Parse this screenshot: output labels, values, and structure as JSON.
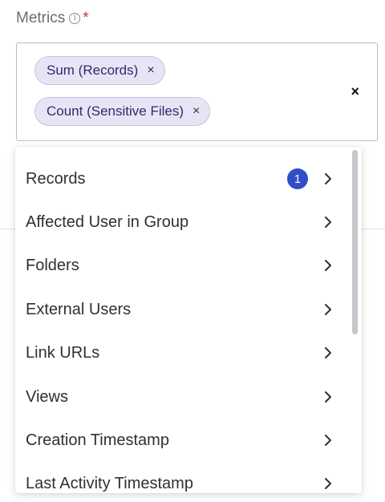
{
  "field": {
    "label": "Metrics",
    "info_glyph": "i",
    "required_mark": "*"
  },
  "selected_chips": [
    {
      "label": "Sum (Records)",
      "remove_glyph": "×"
    },
    {
      "label": "Count (Sensitive Files)",
      "remove_glyph": "×"
    }
  ],
  "clear_all_glyph": "×",
  "dropdown": {
    "options": [
      {
        "label": "Records",
        "badge": "1"
      },
      {
        "label": "Affected User in Group"
      },
      {
        "label": "Folders"
      },
      {
        "label": "External Users"
      },
      {
        "label": "Link URLs"
      },
      {
        "label": "Views"
      },
      {
        "label": "Creation Timestamp"
      },
      {
        "label": "Last Activity Timestamp"
      }
    ]
  },
  "colors": {
    "chip_bg": "#e8e4f5",
    "badge_bg": "#2f4ec7",
    "required": "#d0302f"
  }
}
